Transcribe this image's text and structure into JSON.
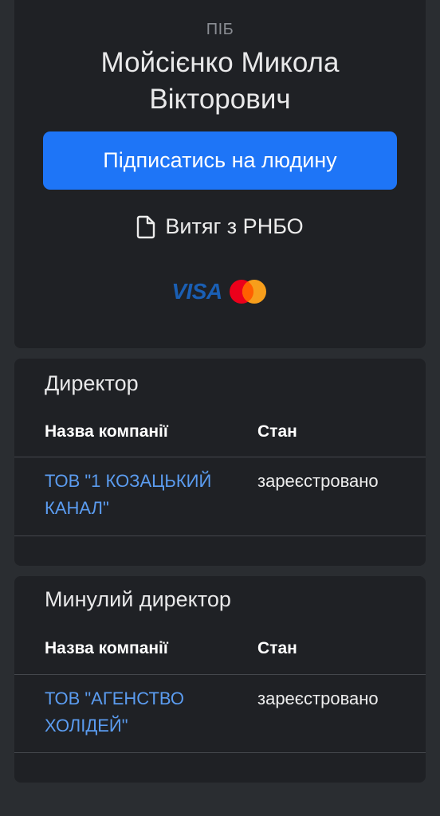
{
  "profile": {
    "name_label": "ПІБ",
    "full_name": "Мойсієнко Микола Вікторович",
    "subscribe_label": "Підписатись на людину",
    "extract_label": "Витяг з РНБО",
    "payment": {
      "visa_text": "VISA",
      "visa_color": "#1a5fb4",
      "mastercard_colors": [
        "#eb001b",
        "#f79e1b"
      ]
    }
  },
  "sections": [
    {
      "title": "Директор",
      "headers": {
        "company": "Назва компанії",
        "status": "Стан"
      },
      "rows": [
        {
          "company": "ТОВ \"1 КОЗАЦЬКИЙ КАНАЛ\"",
          "status": "зареєстровано"
        }
      ]
    },
    {
      "title": "Минулий директор",
      "headers": {
        "company": "Назва компанії",
        "status": "Стан"
      },
      "rows": [
        {
          "company": "ТОВ \"АГЕНСТВО ХОЛІДЕЙ\"",
          "status": "зареєстровано"
        }
      ]
    }
  ],
  "colors": {
    "background": "#2a2d31",
    "card": "#1f2125",
    "accent": "#1e75f7",
    "link": "#5b9cf0"
  }
}
